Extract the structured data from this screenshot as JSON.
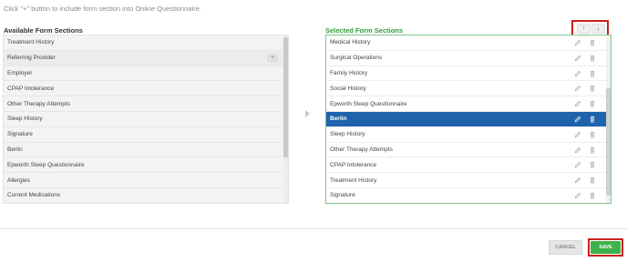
{
  "instruction": "Click \"+\" button to include form section into Online Questionnaire.",
  "available": {
    "title": "Available Form Sections",
    "add_label": "+",
    "items": [
      {
        "label": "Treatment History"
      },
      {
        "label": "Referring Provider"
      },
      {
        "label": "Employer"
      },
      {
        "label": "CPAP Intolerance"
      },
      {
        "label": "Other Therapy Attempts"
      },
      {
        "label": "Sleep History"
      },
      {
        "label": "Signature"
      },
      {
        "label": "Berlin"
      },
      {
        "label": "Epworth Sleep Questionnaire"
      },
      {
        "label": "Allergies"
      },
      {
        "label": "Current Medications"
      }
    ]
  },
  "selected": {
    "title": "Selected Form Sections",
    "move_up_label": "↑",
    "move_down_label": "↓",
    "items": [
      {
        "label": "Medical History",
        "selected": false
      },
      {
        "label": "Surgical Operations",
        "selected": false
      },
      {
        "label": "Family History",
        "selected": false
      },
      {
        "label": "Social History",
        "selected": false
      },
      {
        "label": "Epworth Sleep Questionnaire",
        "selected": false
      },
      {
        "label": "Berlin",
        "selected": true
      },
      {
        "label": "Sleep History",
        "selected": false
      },
      {
        "label": "Other Therapy Attempts",
        "selected": false
      },
      {
        "label": "CPAP Intolerance",
        "selected": false
      },
      {
        "label": "Treatment History",
        "selected": false
      },
      {
        "label": "Signature",
        "selected": false
      }
    ]
  },
  "icons": {
    "edit": "pencil-icon",
    "delete": "trash-icon",
    "transfer": "arrow-right-icon"
  },
  "footer": {
    "cancel_label": "CANCEL",
    "save_label": "SAVE"
  },
  "colors": {
    "selected_title": "#2e9e3a",
    "selected_row": "#1f63ad",
    "save_button": "#3db14a",
    "highlight_outline": "#cc1f1f"
  }
}
